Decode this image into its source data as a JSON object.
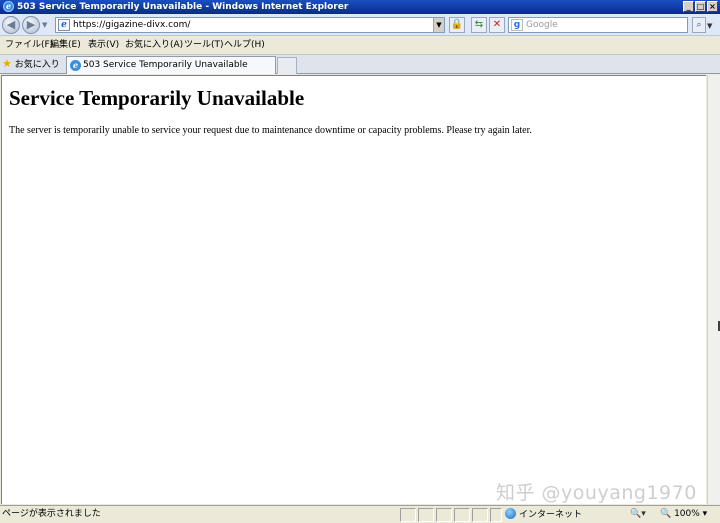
{
  "window": {
    "title": "503 Service Temporarily Unavailable - Windows Internet Explorer",
    "app_icon": "ie-icon"
  },
  "address_bar": {
    "url": "https://gigazine-divx.com/",
    "search_placeholder": "Google"
  },
  "menu": {
    "items": [
      "ファイル(F)",
      "編集(E)",
      "表示(V)",
      "お気に入り(A)",
      "ツール(T)",
      "ヘルプ(H)"
    ]
  },
  "favorites": {
    "label": "お気に入り"
  },
  "tabs": [
    {
      "label": "503 Service Temporarily Unavailable"
    }
  ],
  "page": {
    "heading": "Service Temporarily Unavailable",
    "message": "The server is temporarily unable to service your request due to maintenance downtime or capacity problems. Please try again later."
  },
  "status_bar": {
    "text": "ページが表示されました",
    "zone": "インターネット",
    "zoom": "100%"
  },
  "watermark": "知乎 @youyang1970",
  "colors": {
    "titlebar": "#0a2a8a",
    "chrome": "#ece9d8",
    "content_bg": "#ffffff"
  }
}
